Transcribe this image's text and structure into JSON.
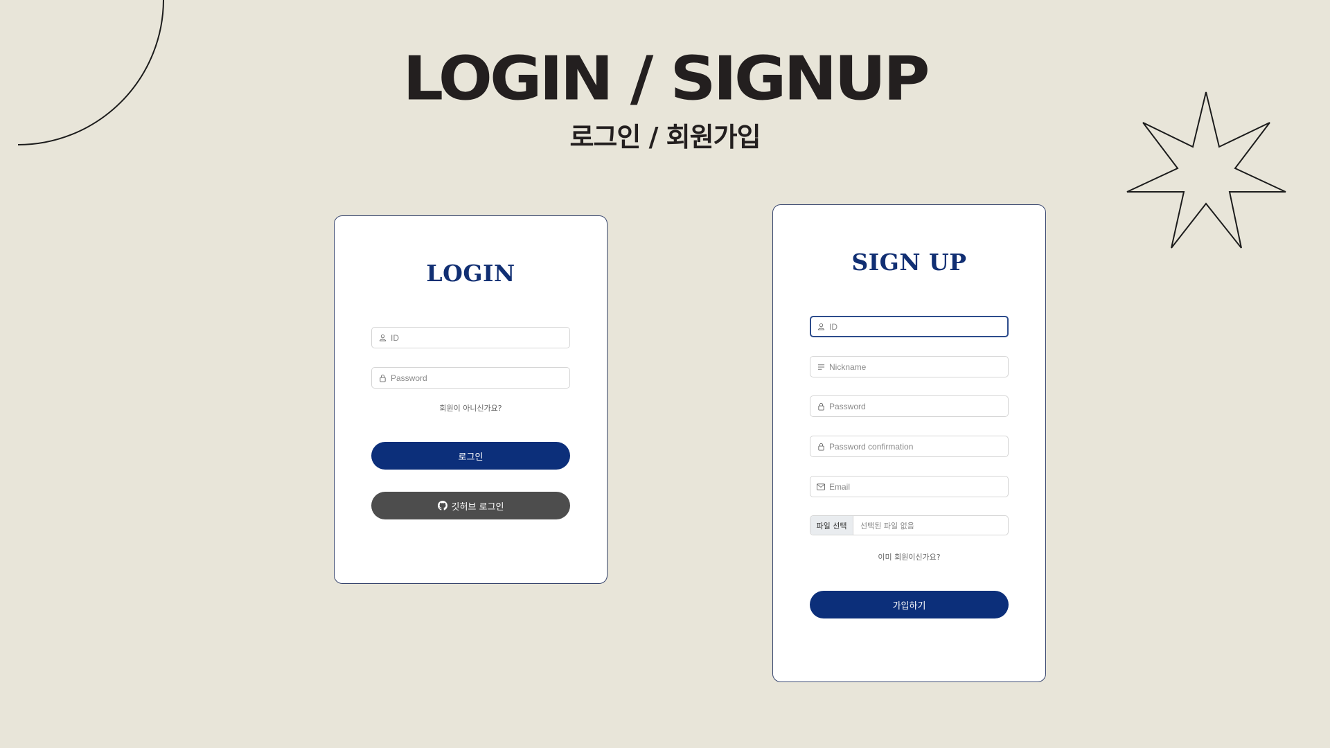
{
  "page": {
    "title": "LOGIN / SIGNUP",
    "subtitle": "로그인 / 회원가입"
  },
  "login": {
    "heading": "LOGIN",
    "fields": [
      {
        "icon": "user-icon",
        "placeholder": "ID",
        "value": ""
      },
      {
        "icon": "lock-icon",
        "placeholder": "Password",
        "value": ""
      }
    ],
    "signup_link": "회원이 아니신가요?",
    "submit_label": "로그인",
    "github_label": "깃허브 로그인",
    "github_icon": "github-icon"
  },
  "signup": {
    "heading": "SIGN UP",
    "fields": [
      {
        "icon": "user-icon",
        "placeholder": "ID",
        "value": ""
      },
      {
        "icon": "menu-lines-icon",
        "placeholder": "Nickname",
        "value": ""
      },
      {
        "icon": "lock-icon",
        "placeholder": "Password",
        "value": ""
      },
      {
        "icon": "lock-icon",
        "placeholder": "Password confirmation",
        "value": ""
      },
      {
        "icon": "mail-icon",
        "placeholder": "Email",
        "value": ""
      }
    ],
    "file_button_label": "파일 선택",
    "file_status": "선택된 파일 없음",
    "login_link": "이미 회원이신가요?",
    "submit_label": "가입하기"
  },
  "colors": {
    "background": "#e8e5d9",
    "primary": "#0c2f7a",
    "heading": "#112f73",
    "github_button": "#4d4d4d",
    "title": "#231f1f"
  }
}
